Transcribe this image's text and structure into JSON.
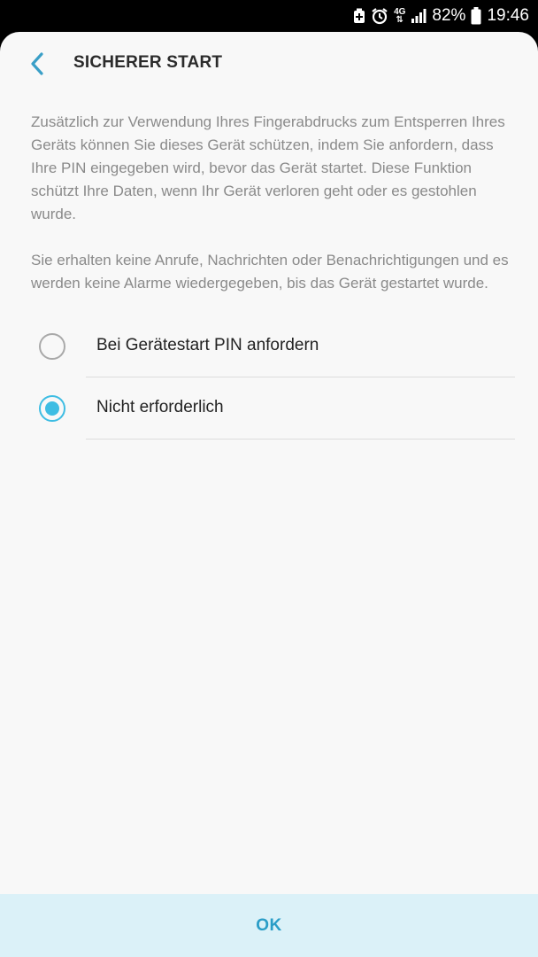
{
  "statusbar": {
    "network": "4G",
    "battery_percent": "82%",
    "time": "19:46",
    "icons": [
      "battery-saver-icon",
      "alarm-icon",
      "network-4g-icon",
      "signal-icon",
      "battery-icon"
    ]
  },
  "header": {
    "title": "SICHERER START",
    "back_icon": "chevron-left-icon"
  },
  "description": {
    "paragraph1": "Zusätzlich zur Verwendung Ihres Fingerabdrucks zum Entsperren Ihres Geräts können Sie dieses Gerät schützen, indem Sie anfordern, dass Ihre PIN eingegeben wird, bevor das Gerät startet. Diese Funktion schützt Ihre Daten, wenn Ihr Gerät verloren geht oder es gestohlen wurde.",
    "paragraph2": "Sie erhalten keine Anrufe, Nachrichten oder Benachrichtigungen und es werden keine Alarme wiedergegeben, bis das Gerät gestartet wurde."
  },
  "options": [
    {
      "label": "Bei Gerätestart PIN anfordern",
      "selected": false
    },
    {
      "label": "Nicht erforderlich",
      "selected": true
    }
  ],
  "footer": {
    "ok_label": "OK"
  },
  "colors": {
    "accent": "#3ebde3",
    "ok_bar": "#dbf1f8",
    "ok_text": "#2a9dc7",
    "background": "#f8f8f8"
  }
}
